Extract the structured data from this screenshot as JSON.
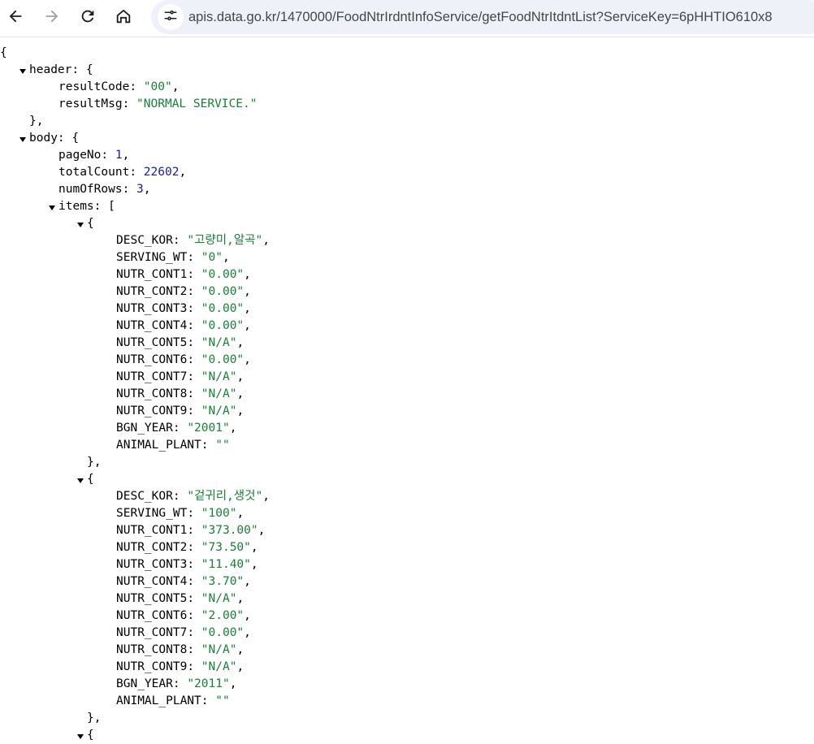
{
  "browser": {
    "url": "apis.data.go.kr/1470000/FoodNtrIrdntInfoService/getFoodNtrItdntList?ServiceKey=6pHHTIO610x8",
    "icons": [
      "back-icon",
      "forward-icon",
      "reload-icon",
      "home-icon",
      "site-settings-icon"
    ]
  },
  "colors": {
    "string": "#188038",
    "number": "#1a1aa6",
    "key": "#000000"
  },
  "json": {
    "open_brace": "{",
    "header": {
      "key": "header",
      "open": ": {",
      "close": "},",
      "resultCode": {
        "key": "resultCode",
        "sep": ": ",
        "value": "\"00\"",
        "end": ","
      },
      "resultMsg": {
        "key": "resultMsg",
        "sep": ": ",
        "value": "\"NORMAL SERVICE.\"",
        "end": ""
      }
    },
    "body": {
      "key": "body",
      "open": ": {",
      "pageNo": {
        "key": "pageNo",
        "sep": ": ",
        "value": "1",
        "end": ","
      },
      "totalCount": {
        "key": "totalCount",
        "sep": ": ",
        "value": "22602",
        "end": ","
      },
      "numOfRows": {
        "key": "numOfRows",
        "sep": ": ",
        "value": "3",
        "end": ","
      },
      "items_key": "items",
      "items_open": ": [",
      "items": [
        {
          "open": "{",
          "close": "},",
          "fields": [
            {
              "key": "DESC_KOR",
              "value": "\"고량미,알곡\""
            },
            {
              "key": "SERVING_WT",
              "value": "\"0\""
            },
            {
              "key": "NUTR_CONT1",
              "value": "\"0.00\""
            },
            {
              "key": "NUTR_CONT2",
              "value": "\"0.00\""
            },
            {
              "key": "NUTR_CONT3",
              "value": "\"0.00\""
            },
            {
              "key": "NUTR_CONT4",
              "value": "\"0.00\""
            },
            {
              "key": "NUTR_CONT5",
              "value": "\"N/A\""
            },
            {
              "key": "NUTR_CONT6",
              "value": "\"0.00\""
            },
            {
              "key": "NUTR_CONT7",
              "value": "\"N/A\""
            },
            {
              "key": "NUTR_CONT8",
              "value": "\"N/A\""
            },
            {
              "key": "NUTR_CONT9",
              "value": "\"N/A\""
            },
            {
              "key": "BGN_YEAR",
              "value": "\"2001\""
            },
            {
              "key": "ANIMAL_PLANT",
              "value": "\"\""
            }
          ]
        },
        {
          "open": "{",
          "close": "},",
          "fields": [
            {
              "key": "DESC_KOR",
              "value": "\"겉귀리,생것\""
            },
            {
              "key": "SERVING_WT",
              "value": "\"100\""
            },
            {
              "key": "NUTR_CONT1",
              "value": "\"373.00\""
            },
            {
              "key": "NUTR_CONT2",
              "value": "\"73.50\""
            },
            {
              "key": "NUTR_CONT3",
              "value": "\"11.40\""
            },
            {
              "key": "NUTR_CONT4",
              "value": "\"3.70\""
            },
            {
              "key": "NUTR_CONT5",
              "value": "\"N/A\""
            },
            {
              "key": "NUTR_CONT6",
              "value": "\"2.00\""
            },
            {
              "key": "NUTR_CONT7",
              "value": "\"0.00\""
            },
            {
              "key": "NUTR_CONT8",
              "value": "\"N/A\""
            },
            {
              "key": "NUTR_CONT9",
              "value": "\"N/A\""
            },
            {
              "key": "BGN_YEAR",
              "value": "\"2011\""
            },
            {
              "key": "ANIMAL_PLANT",
              "value": "\"\""
            }
          ]
        },
        {
          "open": "{"
        }
      ]
    }
  }
}
